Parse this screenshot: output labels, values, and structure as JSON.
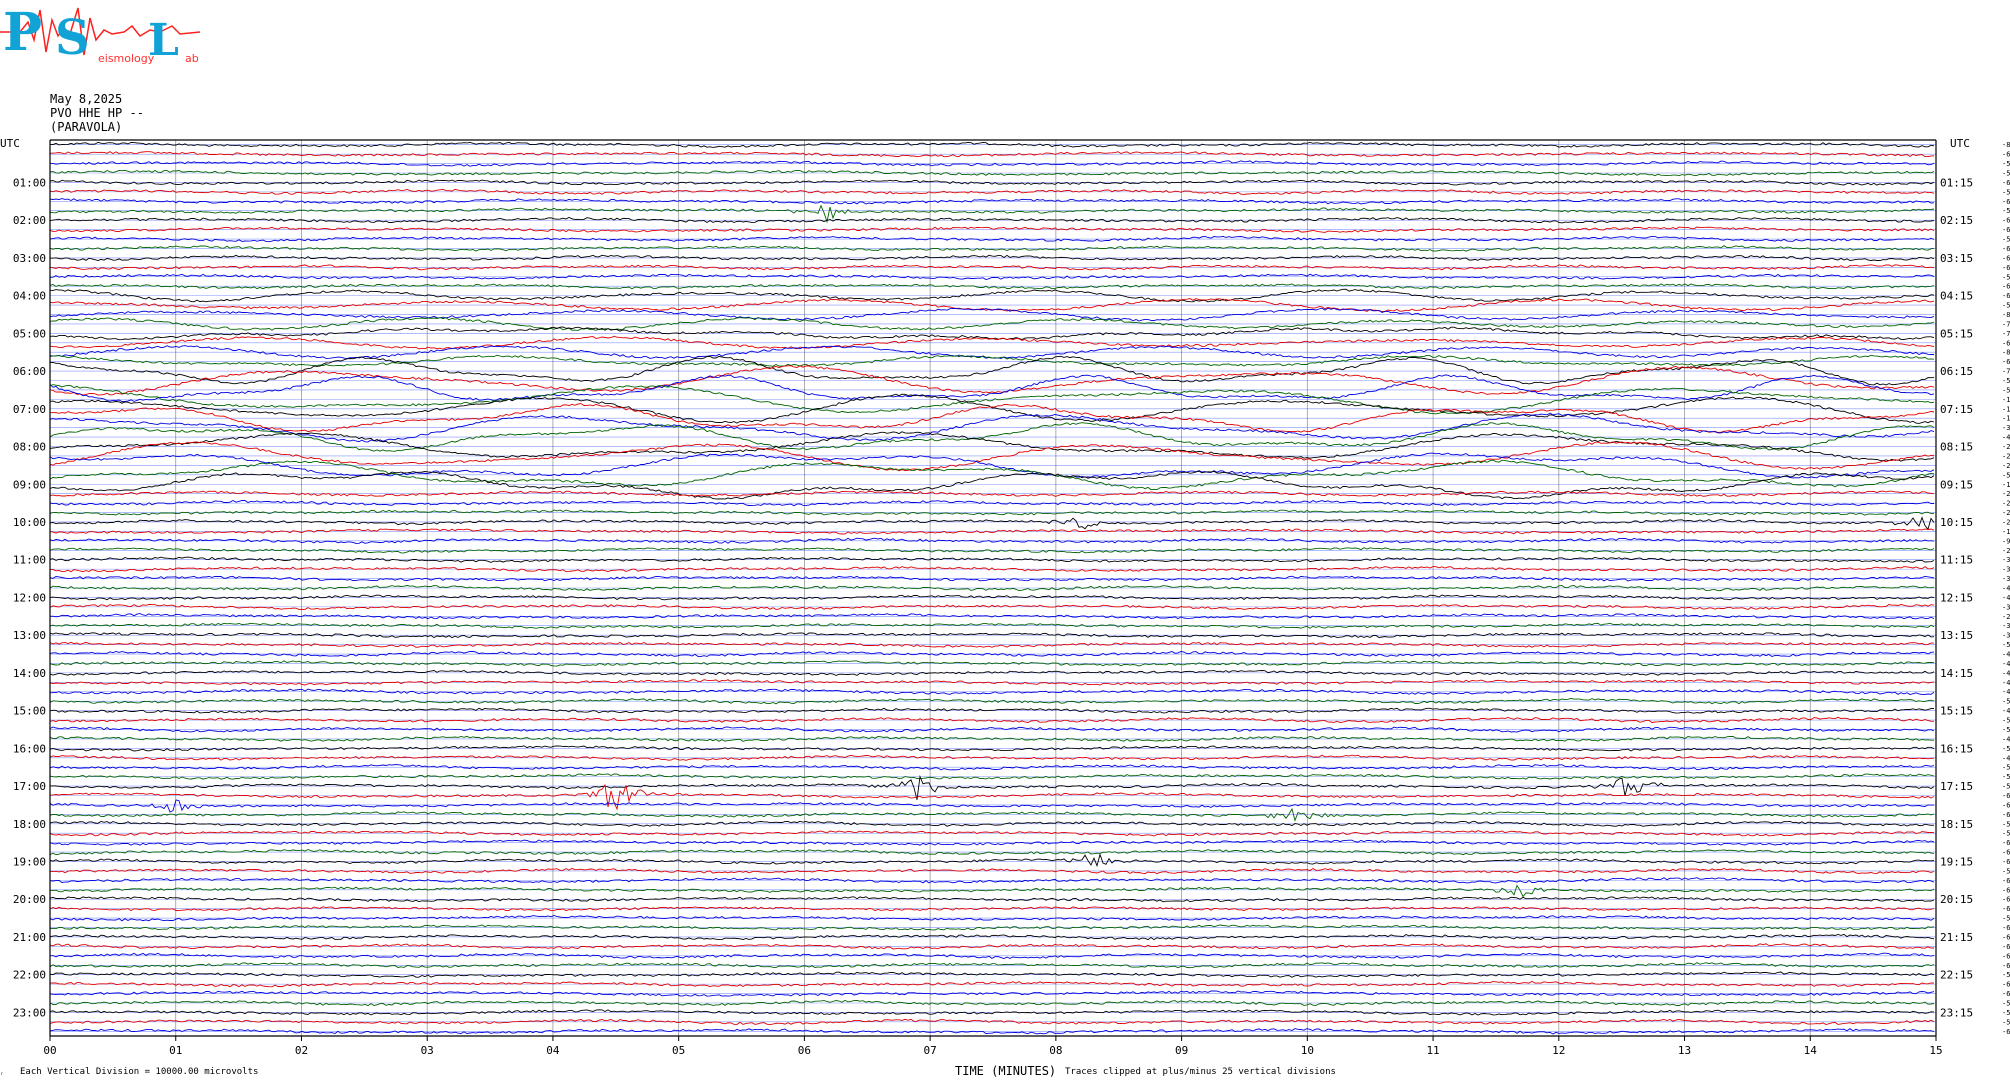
{
  "logo": {
    "letters": [
      "P",
      "S",
      "L"
    ],
    "words": [
      "",
      "eismology",
      "ab"
    ],
    "text_color": "#12a3d6",
    "accent_color": "#ff2020"
  },
  "header": {
    "date": "May 8,2025",
    "station": "PVO HHE HP --",
    "location": "(PARAVOLA)"
  },
  "axis": {
    "utc_label_left": "UTC",
    "utc_label_right": "UTC",
    "xlabel": "TIME (MINUTES)",
    "minute_ticks": [
      "00",
      "01",
      "02",
      "03",
      "04",
      "05",
      "06",
      "07",
      "08",
      "09",
      "10",
      "11",
      "12",
      "13",
      "14",
      "15"
    ]
  },
  "footer": {
    "mark": "ᵣ",
    "vertical_division": "Each Vertical Division = 10000.00 microvolts",
    "clip_note": "Traces clipped at plus/minus 25 vertical divisions"
  },
  "chart_data": {
    "type": "line",
    "title": "",
    "x_range": [
      0,
      15
    ],
    "x_unit": "minutes",
    "grid": true,
    "trace_colors": [
      "#000000",
      "#e00000",
      "#0000e0",
      "#006400"
    ],
    "line_color": "#1a3cff",
    "grid_color": "#999999",
    "left_hour_labels": [
      "01:00",
      "02:00",
      "03:00",
      "04:00",
      "05:00",
      "06:00",
      "07:00",
      "08:00",
      "09:00",
      "10:00",
      "11:00",
      "12:00",
      "13:00",
      "14:00",
      "15:00",
      "16:00",
      "17:00",
      "18:00",
      "19:00",
      "20:00",
      "21:00",
      "22:00",
      "23:00"
    ],
    "right_hour_labels": [
      "01:15",
      "02:15",
      "03:15",
      "04:15",
      "05:15",
      "06:15",
      "07:15",
      "08:15",
      "09:15",
      "10:15",
      "11:15",
      "12:15",
      "13:15",
      "14:15",
      "15:15",
      "16:15",
      "17:15",
      "18:15",
      "19:15",
      "20:15",
      "21:15",
      "22:15",
      "23:15"
    ],
    "trace_offsets": [
      "-8013",
      "-6348",
      "-5947",
      "-5889",
      "-6120",
      "-5909",
      "-6245",
      "-5947",
      "-6290",
      "-6562",
      "-5816",
      "-6024",
      "-6461",
      "-6260",
      "-5971",
      "-6130",
      "-6648",
      "-5706",
      "-8518",
      "-7885",
      "-7345",
      "-6338",
      "-8116",
      "-6106",
      "-7193",
      "-5862",
      "-5632",
      "-1728",
      "-1480",
      "-1946",
      "-3729",
      "-4208",
      "-2342",
      "-2614",
      "-2689",
      "-521",
      "-1662",
      "-2480",
      "-2194",
      "-2146",
      "-2888",
      "-1991",
      "-922",
      "-2608",
      "-3322",
      "-3317",
      "-3187",
      "-4082",
      "-4378",
      "-3727",
      "-2988",
      "-3328",
      "-3924",
      "-5314",
      "-4784",
      "-4783",
      "-4261",
      "-4682",
      "-4444",
      "-5026",
      "-4973",
      "-5387",
      "-5294",
      "-4827",
      "-5993",
      "-4989",
      "-5722",
      "-5233",
      "-5682",
      "-6637",
      "-6163",
      "-6022",
      "-5629",
      "-5620",
      "-6341",
      "-6416",
      "-6066",
      "-5689",
      "-6445",
      "-6198",
      "-6189",
      "-6591",
      "-5689",
      "-6214",
      "-6829",
      "-6369",
      "-6248",
      "-6205",
      "-5877",
      "-6413",
      "-6727",
      "-5974",
      "-5999",
      "-5899",
      "-6308"
    ],
    "events": [
      {
        "row": 7,
        "minute": 6.2,
        "amplitude": "medium"
      },
      {
        "row": 40,
        "minute": 8.2,
        "amplitude": "small"
      },
      {
        "row": 40,
        "minute": 14.9,
        "amplitude": "small"
      },
      {
        "row": 68,
        "minute": 6.85,
        "amplitude": "large"
      },
      {
        "row": 68,
        "minute": 12.55,
        "amplitude": "medium"
      },
      {
        "row": 69,
        "minute": 4.5,
        "amplitude": "large"
      },
      {
        "row": 70,
        "minute": 1.0,
        "amplitude": "small"
      },
      {
        "row": 71,
        "minute": 9.9,
        "amplitude": "medium"
      },
      {
        "row": 76,
        "minute": 8.3,
        "amplitude": "small"
      },
      {
        "row": 79,
        "minute": 11.7,
        "amplitude": "small"
      }
    ]
  }
}
